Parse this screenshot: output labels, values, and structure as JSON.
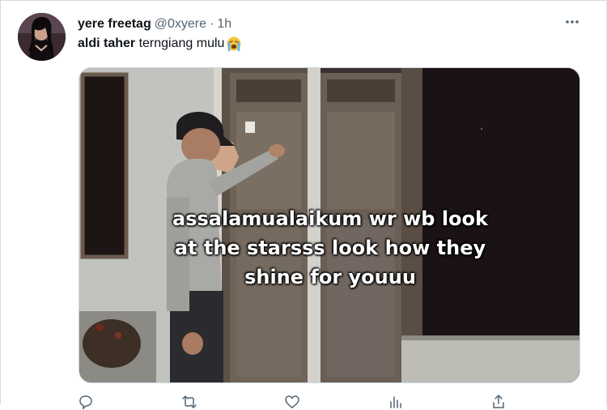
{
  "tweet": {
    "author": {
      "display_name": "yere freetag",
      "handle": "@0xyere",
      "separator": "·",
      "time": "1h"
    },
    "text": {
      "bold": "aldi taher",
      "rest": " terngiang mulu"
    },
    "emoji": "loudly-crying-face-icon",
    "media": {
      "caption_lines": [
        "assalamualaikum wr wb look",
        "at the starsss look how they",
        "shine for youuu"
      ]
    },
    "actions": [
      {
        "name": "reply-icon",
        "count": ""
      },
      {
        "name": "retweet-icon",
        "count": ""
      },
      {
        "name": "like-icon",
        "count": ""
      },
      {
        "name": "views-icon",
        "count": ""
      },
      {
        "name": "share-icon",
        "count": ""
      }
    ]
  },
  "colors": {
    "text_primary": "#0f1419",
    "text_secondary": "#536471",
    "border": "#cfd9de"
  }
}
